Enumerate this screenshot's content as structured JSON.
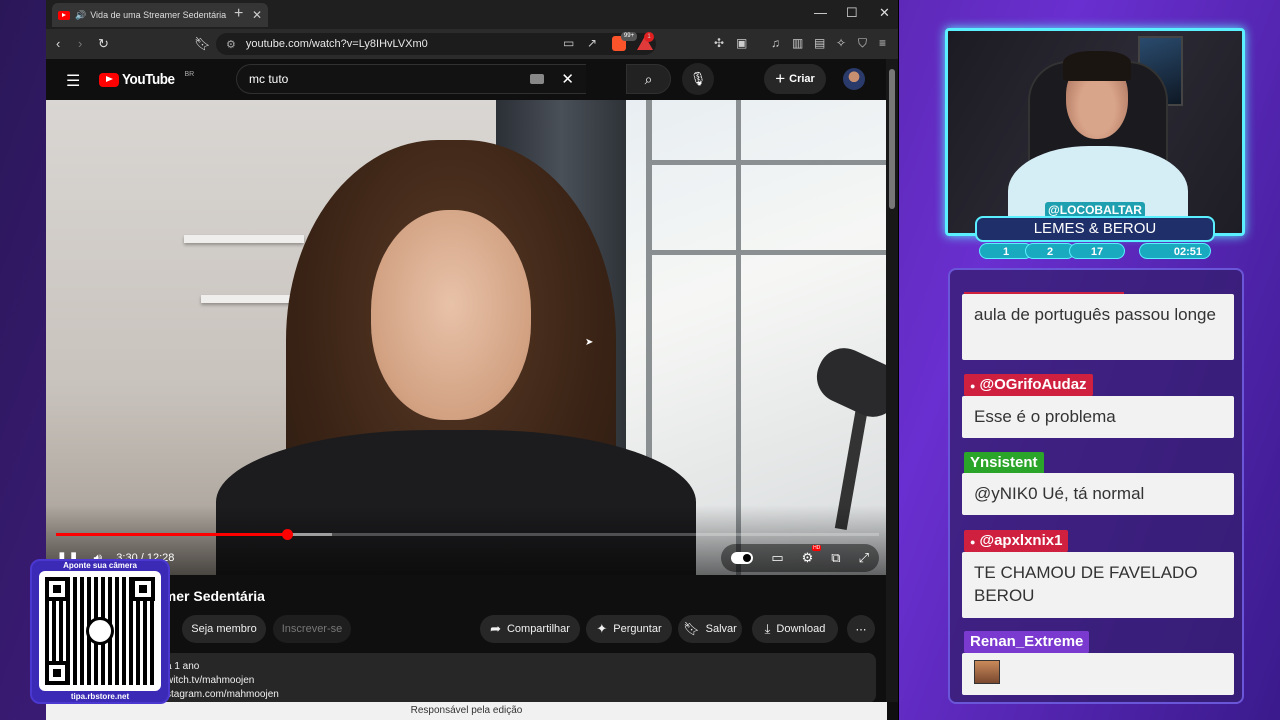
{
  "browser": {
    "tab_title": "Vida de uma Streamer Sedentária",
    "url": "youtube.com/watch?v=Ly8IHvLVXm0",
    "brave_badge": "99+",
    "rewards_badge": "1"
  },
  "youtube": {
    "logo_text": "YouTube",
    "country": "BR",
    "search_value": "mc tuto",
    "create_label": "Criar"
  },
  "player": {
    "time": "3:30 / 12:28",
    "progress": 0.281,
    "buffered": 0.335
  },
  "video": {
    "title": "amer Sedentária",
    "member_label": "Seja membro",
    "subscribe_label": "Inscrever-se",
    "share_label": "Compartilhar",
    "ask_label": "Perguntar",
    "save_label": "Salvar",
    "download_label": "Download",
    "desc_line1": "á 1 ano",
    "desc_line2": "witch.tv/mahmoojen",
    "desc_line3": "stagram.com/mahmoojen"
  },
  "footer_text": "Responsável pela edição",
  "qr": {
    "top_text": "Aponte sua câmera",
    "bottom_text": "tipa.rbstore.net"
  },
  "overlay": {
    "username": "@LOCOBALTAR",
    "teams": "LEMES & BEROU",
    "stats": [
      "1",
      "2",
      "17",
      "02:51"
    ]
  },
  "chat": [
    {
      "user": "",
      "text": "aula de português passou longe",
      "color": "#d02040"
    },
    {
      "user": "@OGrifoAudaz",
      "text": "Esse é o problema",
      "color": "#d02040"
    },
    {
      "user": "Ynsistent",
      "text": "@yNIK0 Ué, tá normal",
      "color": "#2aa52a"
    },
    {
      "user": "@apxlxnix1",
      "text": "TE CHAMOU DE FAVELADO BEROU",
      "color": "#d02040"
    },
    {
      "user": "Renan_Extreme",
      "text": "",
      "color": "#7a3ad0"
    }
  ]
}
